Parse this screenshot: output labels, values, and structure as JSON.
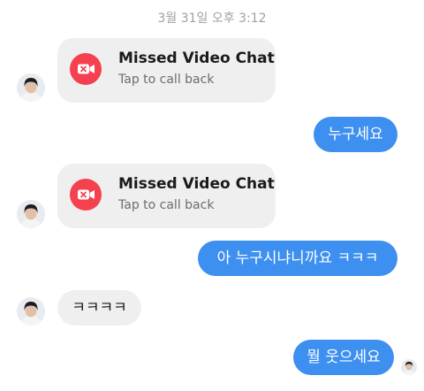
{
  "timestamp": "3월 31일 오후 3:12",
  "missed_call_title": "Missed Video Chat",
  "missed_call_subtitle": "Tap to call back",
  "messages": {
    "out_1": "누구세요",
    "out_2": "아 누구시냐니까요 ㅋㅋㅋ",
    "in_1": "ㅋㅋㅋㅋ",
    "out_3": "뭘 웃으세요"
  },
  "colors": {
    "outgoing_bubble": "#3d8ff0",
    "incoming_bubble": "#efefef",
    "missed_call_icon": "#f4404f"
  },
  "icons": {
    "missed_video_call": "video-camera-with-x-icon",
    "avatar": "profile-photo"
  }
}
